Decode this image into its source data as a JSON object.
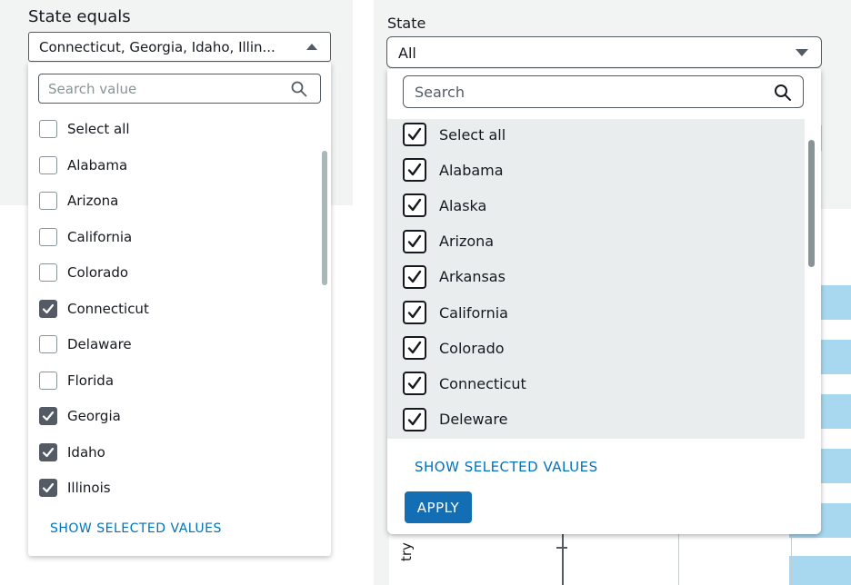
{
  "left_filter": {
    "title": "State equals",
    "selected_text": "Connecticut, Georgia, Idaho, Illin...",
    "search_placeholder": "Search value",
    "items": [
      {
        "label": "Select all",
        "checked": false
      },
      {
        "label": "Alabama",
        "checked": false
      },
      {
        "label": "Arizona",
        "checked": false
      },
      {
        "label": "California",
        "checked": false
      },
      {
        "label": "Colorado",
        "checked": false
      },
      {
        "label": "Connecticut",
        "checked": true
      },
      {
        "label": "Delaware",
        "checked": false
      },
      {
        "label": "Florida",
        "checked": false
      },
      {
        "label": "Georgia",
        "checked": true
      },
      {
        "label": "Idaho",
        "checked": true
      },
      {
        "label": "Illinois",
        "checked": true
      }
    ],
    "show_selected_label": "SHOW SELECTED VALUES"
  },
  "right_filter": {
    "title": "State",
    "selected_text": "All",
    "search_placeholder": "Search",
    "items": [
      {
        "label": "Select all",
        "checked": true
      },
      {
        "label": "Alabama",
        "checked": true
      },
      {
        "label": "Alaska",
        "checked": true
      },
      {
        "label": "Arizona",
        "checked": true
      },
      {
        "label": "Arkansas",
        "checked": true
      },
      {
        "label": "California",
        "checked": true
      },
      {
        "label": "Colorado",
        "checked": true
      },
      {
        "label": "Connecticut",
        "checked": true
      },
      {
        "label": "Deleware",
        "checked": true
      }
    ],
    "show_selected_label": "SHOW SELECTED VALUES",
    "apply_label": "APPLY"
  },
  "background": {
    "axis_fragment": "try"
  },
  "colors": {
    "link": "#0073bb",
    "apply_button": "#146eb4",
    "checked_box_left": "#545b64",
    "bar": "#a8d8f0"
  }
}
